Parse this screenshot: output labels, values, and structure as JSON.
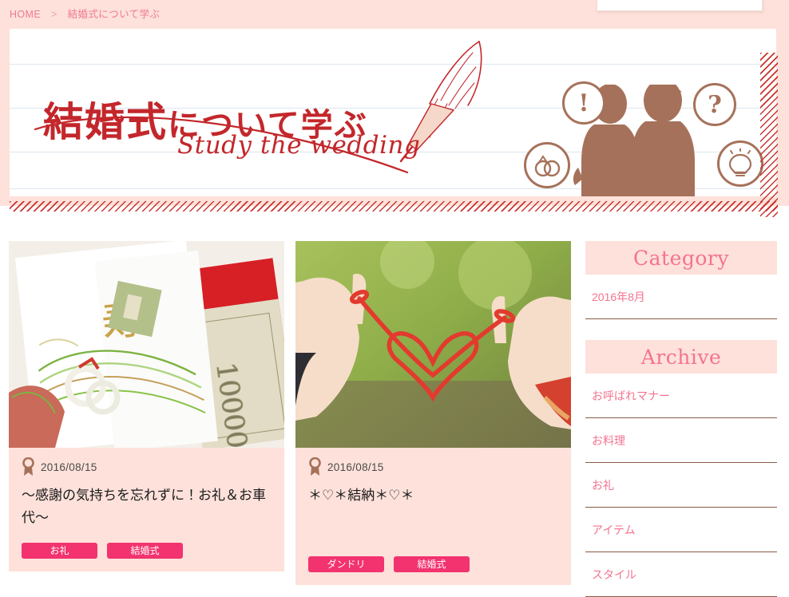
{
  "colors": {
    "page_bg": "#ffffff",
    "strip_bg": "#fde1da",
    "card_bg": "#fde1da",
    "accent_pink": "#f4738f",
    "tag_pink": "#f2336f",
    "hero_red": "#c3272b",
    "silhouette_brown": "#a6715a",
    "divider_brown": "#8a5a44",
    "rule_blue": "#dde6ee"
  },
  "breadcrumb": {
    "home_label": "HOME",
    "separator": ">",
    "current_label": "結婚式について学ぶ"
  },
  "search": {
    "value": "",
    "placeholder": ""
  },
  "hero": {
    "title_jp": "結婚式について学ぶ",
    "title_jp_strong": "結婚式",
    "title_jp_soft": "について学ぶ",
    "title_en": "Study the wedding",
    "bubbles": [
      {
        "icon": "exclamation-icon",
        "glyph": "!"
      },
      {
        "icon": "question-icon",
        "glyph": "?"
      },
      {
        "icon": "wedding-rings-icon",
        "glyph": ""
      },
      {
        "icon": "lightbulb-icon",
        "glyph": ""
      }
    ]
  },
  "articles": [
    {
      "icon": "ribbon-rosette-icon",
      "date": "2016/08/15",
      "title": "〜感謝の気持ちを忘れずに！お礼＆お車代〜",
      "thumb_alt": "祝儀袋と一万円札",
      "tags": [
        "お礼",
        "結婚式"
      ]
    },
    {
      "icon": "ribbon-rosette-icon",
      "date": "2016/08/15",
      "title": "＊♡＊結納＊♡＊",
      "thumb_alt": "赤い糸でハートを作る二つの手",
      "tags": [
        "ダンドリ",
        "結婚式"
      ]
    }
  ],
  "sidebar": {
    "category": {
      "heading": "Category",
      "items": [
        "2016年8月"
      ]
    },
    "archive": {
      "heading": "Archive",
      "items": [
        "お呼ばれマナー",
        "お料理",
        "お礼",
        "アイテム",
        "スタイル"
      ]
    }
  }
}
